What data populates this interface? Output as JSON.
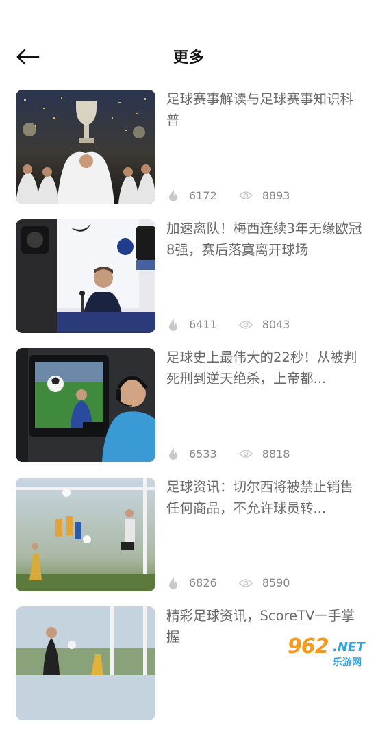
{
  "header": {
    "title": "更多",
    "back_icon": "arrow-left-icon"
  },
  "articles": [
    {
      "title": "足球赛事解读与足球赛事知识科普",
      "hot": "6172",
      "views": "8893",
      "image": "trophy-celebration-photo"
    },
    {
      "title": "加速离队！梅西连续3年无缘欧冠8强，赛后落寞离开球场",
      "hot": "6411",
      "views": "8043",
      "image": "press-conference-photo"
    },
    {
      "title": "足球史上最伟大的22秒！从被判死刑到逆天绝杀，上帝都...",
      "hot": "6533",
      "views": "8818",
      "image": "var-room-photo"
    },
    {
      "title": "足球资讯：切尔西将被禁止销售任何商品，不允许球员转...",
      "hot": "6826",
      "views": "8590",
      "image": "goal-header-photo"
    },
    {
      "title": "精彩足球资讯，ScoreTV一手掌握",
      "hot": "",
      "views": "",
      "image": "match-action-photo"
    }
  ],
  "watermark": {
    "number": "962",
    "suffix": ".NET",
    "site": "乐游网"
  },
  "colors": {
    "title_text": "#6a6a6a",
    "stat_text": "#8a8a8a",
    "icon": "#c9c9c9",
    "watermark_orange": "#f59a1b",
    "watermark_blue": "#2ea3e3"
  }
}
